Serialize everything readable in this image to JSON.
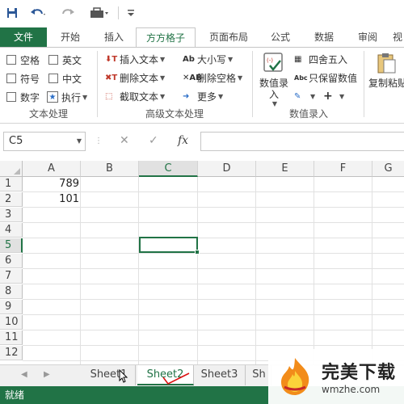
{
  "quick_access": {
    "save_icon": "save-icon",
    "undo_icon": "undo-icon",
    "redo_icon": "redo-icon",
    "toolbox_icon": "toolbox-icon",
    "customize_icon": "customize-icon"
  },
  "tabs": {
    "file": "文件",
    "home": "开始",
    "insert": "插入",
    "fangfang": "方方格子",
    "page_layout": "页面布局",
    "formulas": "公式",
    "data": "数据",
    "review": "审阅",
    "view": "视"
  },
  "ribbon": {
    "text_processing": {
      "label": "文本处理",
      "space": "空格",
      "english": "英文",
      "symbol": "符号",
      "chinese": "中文",
      "digit": "数字",
      "execute": "执行"
    },
    "advanced_text": {
      "label": "高级文本处理",
      "insert_text": "插入文本",
      "delete_text": "删除文本",
      "extract_text": "截取文本",
      "case": "大小写",
      "delete_space": "删除空格",
      "more": "更多"
    },
    "numeric_entry": {
      "label": "数值录入",
      "numeric_entry_btn": "数值录入",
      "round": "四舍五入",
      "keep_value": "只保留数值"
    },
    "copy_paste": {
      "label": "复制粘贴"
    }
  },
  "formula_bar": {
    "name_box": "C5",
    "fx_label": "fx"
  },
  "grid": {
    "columns": [
      "A",
      "B",
      "C",
      "D",
      "E",
      "F",
      "G"
    ],
    "rows": [
      "1",
      "2",
      "3",
      "4",
      "5",
      "6",
      "7",
      "8",
      "9",
      "10",
      "11",
      "12"
    ],
    "cells": {
      "A1": "789",
      "A2": "101"
    },
    "selected_cell": "C5"
  },
  "sheets": {
    "tabs": [
      "Sheet1",
      "Sheet2",
      "Sheet3",
      "Sh"
    ],
    "active": "Sheet2"
  },
  "status_bar": {
    "text": "就绪"
  },
  "watermark": {
    "name": "完美下载",
    "url": "wmzhe.com"
  },
  "colors": {
    "accent": "#217346",
    "status_bar": "#217346"
  }
}
